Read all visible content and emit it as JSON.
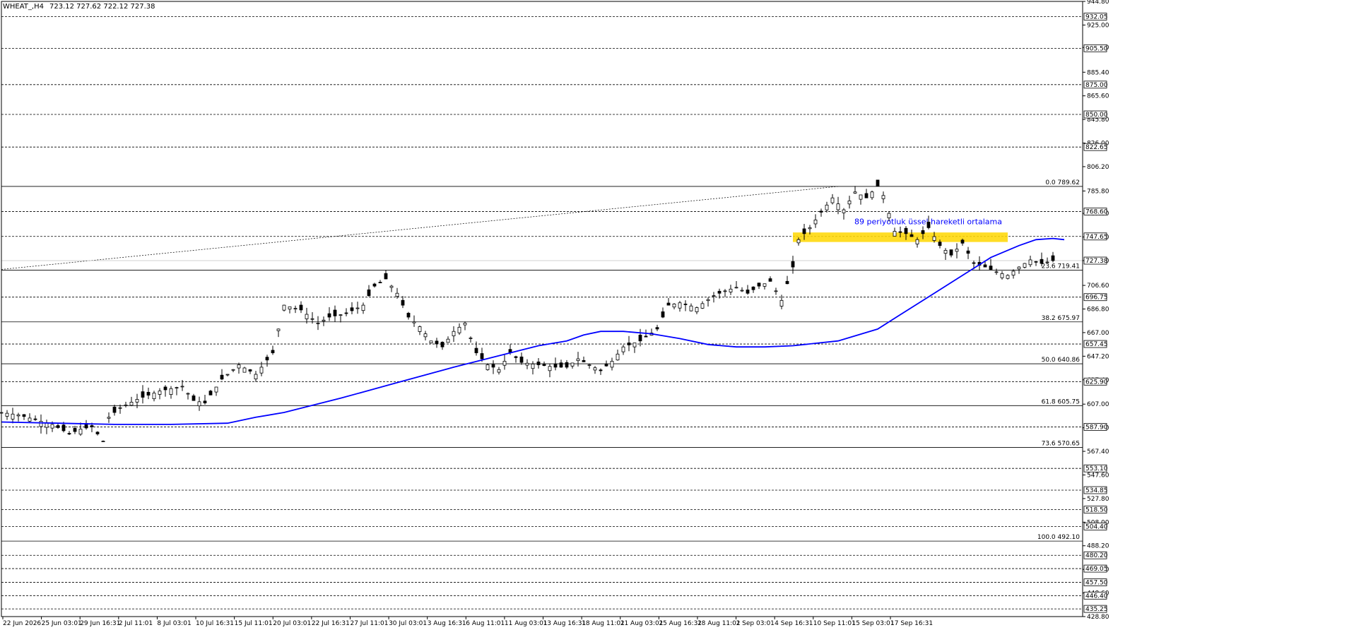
{
  "chart_data": {
    "type": "candlestick",
    "symbol": "WHEAT_,H4",
    "ohlc_header": "723.12 727.62 722.12 727.38",
    "current_price": 727.38,
    "ylim": [
      428.8,
      944.8
    ],
    "y_ticks": [
      "944.80",
      "925.00",
      "906.20",
      "885.40",
      "865.60",
      "845.80",
      "826.00",
      "806.20",
      "785.80",
      "767.00",
      "747.20",
      "727.40",
      "706.60",
      "686.80",
      "667.00",
      "647.20",
      "627.40",
      "607.00",
      "587.20",
      "567.40",
      "547.60",
      "527.80",
      "508.00",
      "488.20",
      "468.40",
      "448.60",
      "428.80"
    ],
    "x_ticks": [
      "22 Jun 2026",
      "25 Jun 03:01",
      "29 Jun 16:31",
      "2 Jul 11:01",
      "8 Jul 03:01",
      "10 Jul 16:31",
      "15 Jul 11:01",
      "20 Jul 03:01",
      "22 Jul 16:31",
      "27 Jul 11:01",
      "30 Jul 03:01",
      "3 Aug 16:31",
      "6 Aug 11:01",
      "11 Aug 03:01",
      "13 Aug 16:31",
      "18 Aug 11:01",
      "21 Aug 03:01",
      "25 Aug 16:31",
      "28 Aug 11:01",
      "2 Sep 03:01",
      "4 Sep 16:31",
      "10 Sep 11:01",
      "15 Sep 03:01",
      "17 Sep 16:31"
    ],
    "dashed_levels": [
      932.05,
      905.5,
      875.0,
      850.0,
      822.65,
      768.6,
      747.65,
      696.75,
      657.45,
      625.9,
      587.9,
      553.1,
      534.85,
      518.5,
      504.4,
      480.2,
      469.05,
      457.5,
      446.4,
      435.25
    ],
    "fibonacci": [
      {
        "label": "0.0 789.62",
        "value": 789.62
      },
      {
        "label": "23.6 719.41",
        "value": 719.41
      },
      {
        "label": "38.2 675.97",
        "value": 675.97
      },
      {
        "label": "50.0 640.86",
        "value": 640.86
      },
      {
        "label": "61.8 605.75",
        "value": 605.75
      },
      {
        "label": "73.6 570.65",
        "value": 570.65
      },
      {
        "label": "100.0 492.10",
        "value": 492.1
      }
    ],
    "resistance_zone": [
      743,
      751
    ],
    "ema_label": "89 periyotluk üssel hareketli ortalama",
    "ema_color": "#0000ff",
    "zone_color": "#ffd700",
    "ema_points": [
      [
        0,
        592
      ],
      [
        10,
        591
      ],
      [
        20,
        590
      ],
      [
        30,
        590
      ],
      [
        40,
        591
      ],
      [
        45,
        596
      ],
      [
        50,
        600
      ],
      [
        60,
        612
      ],
      [
        70,
        625
      ],
      [
        80,
        638
      ],
      [
        90,
        650
      ],
      [
        95,
        656
      ],
      [
        100,
        660
      ],
      [
        103,
        665
      ],
      [
        106,
        668
      ],
      [
        110,
        668
      ],
      [
        115,
        666
      ],
      [
        120,
        662
      ],
      [
        125,
        657
      ],
      [
        130,
        655
      ],
      [
        135,
        655
      ],
      [
        140,
        656
      ],
      [
        148,
        660
      ],
      [
        155,
        670
      ],
      [
        160,
        685
      ],
      [
        165,
        700
      ],
      [
        170,
        715
      ],
      [
        175,
        730
      ],
      [
        180,
        740
      ],
      [
        183,
        745
      ],
      [
        186,
        746
      ],
      [
        188,
        745
      ]
    ],
    "close_points": [
      [
        0,
        600
      ],
      [
        3,
        598
      ],
      [
        6,
        594
      ],
      [
        9,
        590
      ],
      [
        12,
        582
      ],
      [
        14,
        586
      ],
      [
        16,
        588
      ],
      [
        18,
        576
      ],
      [
        19,
        596
      ],
      [
        21,
        604
      ],
      [
        24,
        611
      ],
      [
        28,
        618
      ],
      [
        32,
        622
      ],
      [
        34,
        610
      ],
      [
        36,
        608
      ],
      [
        39,
        628
      ],
      [
        42,
        640
      ],
      [
        45,
        632
      ],
      [
        48,
        650
      ],
      [
        50,
        690
      ],
      [
        53,
        686
      ],
      [
        56,
        675
      ],
      [
        58,
        680
      ],
      [
        61,
        683
      ],
      [
        64,
        690
      ],
      [
        66,
        706
      ],
      [
        68,
        712
      ],
      [
        70,
        700
      ],
      [
        72,
        680
      ],
      [
        74,
        672
      ],
      [
        76,
        660
      ],
      [
        78,
        655
      ],
      [
        80,
        668
      ],
      [
        82,
        675
      ],
      [
        84,
        650
      ],
      [
        86,
        640
      ],
      [
        88,
        636
      ],
      [
        90,
        650
      ],
      [
        92,
        642
      ],
      [
        95,
        640
      ],
      [
        98,
        638
      ],
      [
        100,
        638
      ],
      [
        102,
        645
      ],
      [
        104,
        640
      ],
      [
        106,
        635
      ],
      [
        108,
        643
      ],
      [
        110,
        655
      ],
      [
        113,
        660
      ],
      [
        116,
        670
      ],
      [
        118,
        690
      ],
      [
        120,
        692
      ],
      [
        123,
        688
      ],
      [
        126,
        698
      ],
      [
        128,
        702
      ],
      [
        130,
        705
      ],
      [
        132,
        700
      ],
      [
        134,
        706
      ],
      [
        136,
        710
      ],
      [
        138,
        694
      ],
      [
        140,
        722
      ],
      [
        141,
        745
      ],
      [
        143,
        755
      ],
      [
        145,
        768
      ],
      [
        147,
        780
      ],
      [
        149,
        770
      ],
      [
        151,
        785
      ],
      [
        153,
        780
      ],
      [
        155,
        790
      ],
      [
        156,
        782
      ],
      [
        158,
        752
      ],
      [
        160,
        750
      ],
      [
        162,
        745
      ],
      [
        164,
        755
      ],
      [
        166,
        740
      ],
      [
        168,
        732
      ],
      [
        170,
        742
      ],
      [
        172,
        725
      ],
      [
        174,
        722
      ],
      [
        176,
        718
      ],
      [
        178,
        715
      ],
      [
        180,
        722
      ],
      [
        182,
        728
      ],
      [
        184,
        725
      ],
      [
        186,
        727.38
      ]
    ]
  }
}
